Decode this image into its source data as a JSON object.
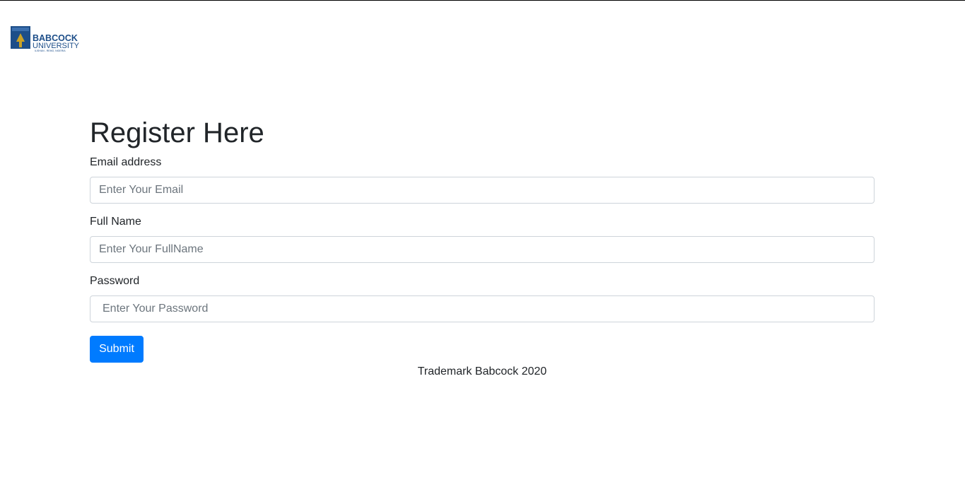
{
  "brand": {
    "logo_line1": "BABCOCK",
    "logo_line2": "UNIVERSITY",
    "logo_tagline": "ILISHAN - REMO, NIGERIA",
    "logo_color": "#1d4e89"
  },
  "page": {
    "title": "Register Here"
  },
  "form": {
    "email": {
      "label": "Email address",
      "placeholder": "Enter Your Email"
    },
    "full_name": {
      "label": "Full Name",
      "placeholder": "Enter Your FullName"
    },
    "password": {
      "label": "Password",
      "placeholder": "Enter Your Password"
    },
    "submit_label": "Submit",
    "accent_color": "#007bff"
  },
  "footer": {
    "text": "Trademark Babcock 2020"
  }
}
